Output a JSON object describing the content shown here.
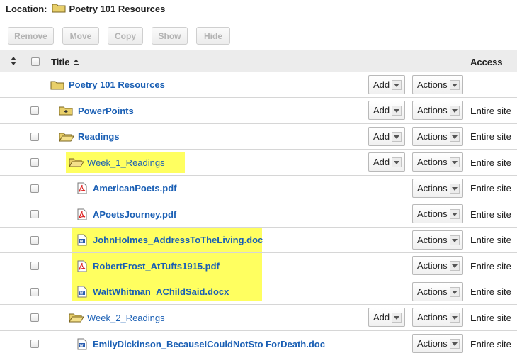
{
  "location": {
    "label": "Location:",
    "path": "Poetry 101 Resources"
  },
  "toolbar": {
    "remove": "Remove",
    "move": "Move",
    "copy": "Copy",
    "show": "Show",
    "hide": "Hide"
  },
  "header": {
    "title": "Title",
    "access": "Access"
  },
  "rows": [
    {
      "name": "Poetry 101 Resources",
      "type": "folder-root",
      "add": "Add",
      "actions": "Actions",
      "access": ""
    },
    {
      "name": "PowerPoints",
      "type": "folder-closed",
      "add": "Add",
      "actions": "Actions",
      "access": "Entire site"
    },
    {
      "name": "Readings",
      "type": "folder-open",
      "add": "Add",
      "actions": "Actions",
      "access": "Entire site"
    },
    {
      "name": "Week_1_Readings",
      "type": "folder-open",
      "add": "Add",
      "actions": "Actions",
      "access": "Entire site"
    },
    {
      "name": "AmericanPoets.pdf",
      "type": "pdf",
      "actions": "Actions",
      "access": "Entire site"
    },
    {
      "name": "APoetsJourney.pdf",
      "type": "pdf",
      "actions": "Actions",
      "access": "Entire site"
    },
    {
      "name": "JohnHolmes_AddressToTheLiving.doc",
      "type": "doc",
      "actions": "Actions",
      "access": "Entire site"
    },
    {
      "name": "RobertFrost_AtTufts1915.pdf",
      "type": "pdf",
      "actions": "Actions",
      "access": "Entire site"
    },
    {
      "name": "WaltWhitman_AChildSaid.docx",
      "type": "doc",
      "actions": "Actions",
      "access": "Entire site"
    },
    {
      "name": "Week_2_Readings",
      "type": "folder-open",
      "add": "Add",
      "actions": "Actions",
      "access": "Entire site"
    },
    {
      "name": "EmilyDickinson_BecauseICouldNotSto ForDeath.doc",
      "type": "doc",
      "actions": "Actions",
      "access": "Entire site"
    }
  ]
}
